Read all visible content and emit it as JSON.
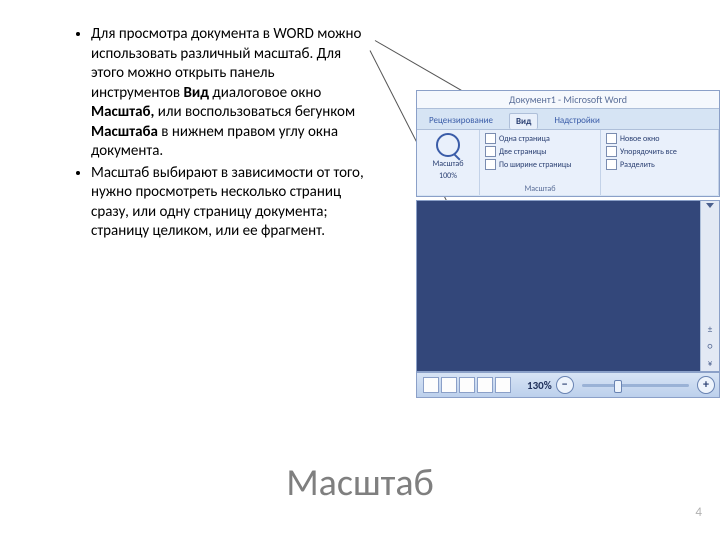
{
  "bullets": {
    "b1_pre": "Для просмотра документа в WORD можно использовать различный масштаб. Для этого можно открыть панель инструментов ",
    "b1_bold1": "Вид",
    "b1_mid": " диалоговое окно ",
    "b1_bold2": "Масштаб,",
    "b1_mid2": " или воспользоваться бегунком ",
    "b1_bold3": "Масштаба",
    "b1_post": " в нижнем правом углу окна документа.",
    "b2": "Масштаб выбирают в зависимости от того, нужно просмотреть несколько страниц сразу, или одну страницу документа; страницу целиком, или ее фрагмент."
  },
  "ribbon": {
    "title": "Документ1 - Microsoft Word",
    "tabs": {
      "review": "Рецензирование",
      "view": "Вид",
      "addins": "Надстройки"
    },
    "zoom_group": {
      "zoom_label": "Масштаб",
      "pct": "100%",
      "one_page": "Одна страница",
      "two_pages": "Две страницы",
      "page_width": "По ширине страницы",
      "group_name": "Масштаб"
    },
    "window_group": {
      "new_window": "Новое окно",
      "arrange": "Упорядочить все",
      "split": "Разделить"
    }
  },
  "scrollbar": {
    "marks": [
      "±",
      "○",
      "¥"
    ]
  },
  "statusbar": {
    "zoom_pct": "130%",
    "minus": "−",
    "plus": "+"
  },
  "slide_title": "Масштаб",
  "page_number": "4"
}
